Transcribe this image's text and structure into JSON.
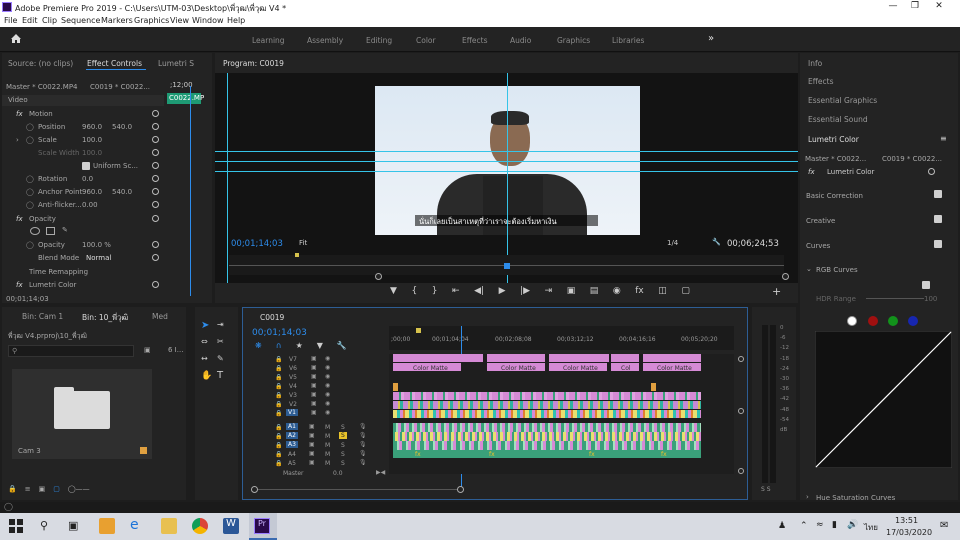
{
  "titlebar": {
    "title": "Adobe Premiere Pro 2019 - C:\\Users\\UTM-03\\Desktop\\พี่วุฒ\\พี่วุฒ V4 *"
  },
  "menu": [
    "File",
    "Edit",
    "Clip",
    "Sequence",
    "Markers",
    "Graphics",
    "View",
    "Window",
    "Help"
  ],
  "workspaces": [
    "Learning",
    "Assembly",
    "Editing",
    "Color",
    "Effects",
    "Audio",
    "Graphics",
    "Libraries"
  ],
  "source_panel": {
    "tab_source": "Source: (no clips)",
    "tab_effect": "Effect Controls",
    "tab_lumetri": "Lumetri S",
    "master": "Master * C0022.MP4",
    "seq": "C0019 * C0022...",
    "clip_badge": "C0022.MP",
    "timecode_top": ";12;00",
    "section_video": "Video",
    "motion": "Motion",
    "position_label": "Position",
    "position_x": "960.0",
    "position_y": "540.0",
    "scale_label": "Scale",
    "scale_val": "100.0",
    "scale_width_label": "Scale Width",
    "scale_width_val": "100.0",
    "uniform_label": "Uniform Sc...",
    "rotation_label": "Rotation",
    "rotation_val": "0.0",
    "anchor_label": "Anchor Point",
    "anchor_x": "960.0",
    "anchor_y": "540.0",
    "antiflicker_label": "Anti-flicker...",
    "antiflicker_val": "0.00",
    "opacity": "Opacity",
    "opacity_label": "Opacity",
    "opacity_val": "100.0 %",
    "blend_label": "Blend Mode",
    "blend_val": "Normal",
    "time_remap": "Time Remapping",
    "lumetri": "Lumetri Color",
    "timecode_bottom": "00;01;14;03"
  },
  "program": {
    "tab": "Program: C0019",
    "subtitle": "นั่นก็เลยเป็นสาเหตุที่ว่าเราจะต้องเริ่มหาเงิน",
    "timecode": "00;01;14;03",
    "fit": "Fit",
    "res": "1/4",
    "duration": "00;06;24;53"
  },
  "right_panel": {
    "items": [
      "Info",
      "Effects",
      "Essential Graphics",
      "Essential Sound",
      "Lumetri Color"
    ],
    "master": "Master * C0022...",
    "seq": "C0019 * C0022...",
    "fx_name": "Lumetri Color",
    "sections": [
      "Basic Correction",
      "Creative",
      "Curves"
    ],
    "rgb_curves": "RGB Curves",
    "hdr_range": "HDR Range",
    "hdr_val": "100",
    "hue_sat": "Hue Saturation Curves"
  },
  "project": {
    "tab1": "Bin: Cam 1",
    "tab2": "Bin: 10_พี่วุฒิ",
    "tab3": "Med",
    "path": "พี่วุฒ V4.prproj\\10_พี่วุฒิ",
    "count": "6 I...",
    "folder_label": "Cam 3"
  },
  "timeline": {
    "tab": "C0019",
    "timecode": "00;01;14;03",
    "ruler": [
      ";00;00",
      "00;01;04;04",
      "00;02;08;08",
      "00;03;12;12",
      "00;04;16;16",
      "00;05;20;20"
    ],
    "video_tracks": [
      "V7",
      "V6",
      "V5",
      "V4",
      "V3",
      "V2",
      "V1"
    ],
    "audio_tracks": [
      "A1",
      "A2",
      "A3",
      "A4",
      "A5"
    ],
    "master_label": "Master",
    "master_val": "0.0",
    "clip_names": [
      "Color Matte",
      "Color Matte",
      "Color Matte",
      "Color Matte",
      "Col",
      "Color Matte"
    ],
    "fx_badge": "fx",
    "mute": "M",
    "solo": "S"
  },
  "meter": {
    "labels": [
      "0",
      "-6",
      "-12",
      "-18",
      "-24",
      "-30",
      "-36",
      "-42",
      "-48",
      "-54",
      "dB"
    ],
    "bottom": "S S"
  },
  "taskbar": {
    "time": "13:51",
    "date": "17/03/2020",
    "lang": "ไทย"
  }
}
